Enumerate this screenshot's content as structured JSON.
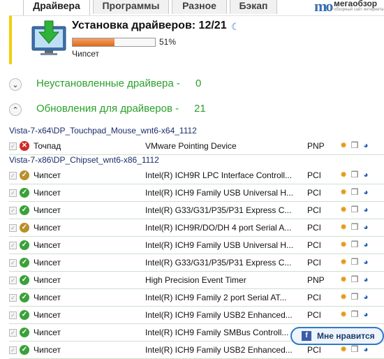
{
  "tabs": [
    {
      "label": "Драйвера",
      "active": true
    },
    {
      "label": "Программы",
      "active": false
    },
    {
      "label": "Разное",
      "active": false
    },
    {
      "label": "Бэкап",
      "active": false
    }
  ],
  "logo": {
    "mark": "mo",
    "name": "мегаобзор",
    "sub": "обзорный сайт интернета"
  },
  "install": {
    "title": "Установка драйверов: 12/21",
    "progress_percent": 51,
    "percent_label": "51%",
    "current_item": "Чипсет"
  },
  "sections": {
    "not_installed": {
      "label": "Неустановленные драйвера -",
      "count": "0"
    },
    "updates": {
      "label": "Обновления для драйверов -",
      "count": "21"
    }
  },
  "groups": [
    {
      "path": "Vista-7-x64\\DP_Touchpad_Mouse_wnt6-x64_1112",
      "rows": [
        {
          "name": "Точпад",
          "desc": "VMware Pointing Device",
          "bus": "PNP",
          "status": "err"
        }
      ]
    },
    {
      "path": "Vista-7-x86\\DP_Chipset_wnt6-x86_1112",
      "rows": [
        {
          "name": "Чипсет",
          "desc": "Intel(R) ICH9R LPC Interface Controll...",
          "bus": "PCI",
          "status": "warn"
        },
        {
          "name": "Чипсет",
          "desc": "Intel(R) ICH9 Family USB Universal H...",
          "bus": "PCI",
          "status": "ok"
        },
        {
          "name": "Чипсет",
          "desc": "Intel(R) G33/G31/P35/P31 Express C...",
          "bus": "PCI",
          "status": "ok"
        },
        {
          "name": "Чипсет",
          "desc": "Intel(R) ICH9R/DO/DH 4 port Serial A...",
          "bus": "PCI",
          "status": "warn"
        },
        {
          "name": "Чипсет",
          "desc": "Intel(R) ICH9 Family USB Universal H...",
          "bus": "PCI",
          "status": "ok"
        },
        {
          "name": "Чипсет",
          "desc": "Intel(R) G33/G31/P35/P31 Express C...",
          "bus": "PCI",
          "status": "ok"
        },
        {
          "name": "Чипсет",
          "desc": "High Precision Event Timer",
          "bus": "PNP",
          "status": "ok"
        },
        {
          "name": "Чипсет",
          "desc": "Intel(R) ICH9 Family 2 port Serial AT...",
          "bus": "PCI",
          "status": "ok"
        },
        {
          "name": "Чипсет",
          "desc": "Intel(R) ICH9 Family USB2 Enhanced...",
          "bus": "PCI",
          "status": "ok"
        },
        {
          "name": "Чипсет",
          "desc": "Intel(R) ICH9 Family SMBus Controll...",
          "bus": "PCI",
          "status": "ok"
        },
        {
          "name": "Чипсет",
          "desc": "Intel(R) ICH9 Family USB2 Enhanced...",
          "bus": "PCI",
          "status": "ok"
        }
      ]
    }
  ],
  "like_button": {
    "label": "Мне нравится"
  },
  "icons": {
    "checkbox": "checkbox-icon",
    "sun": "settings-sun-icon",
    "doc": "driver-info-icon",
    "globe": "web-icon"
  },
  "colors": {
    "accent_green": "#2aa02a",
    "highlight_yellow": "#f2d000",
    "progress_orange": "#e06a1a",
    "path_blue": "#1a2d6a"
  }
}
